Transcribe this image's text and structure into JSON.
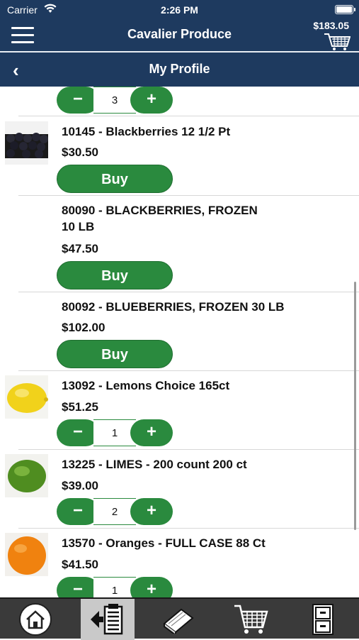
{
  "status_bar": {
    "carrier": "Carrier",
    "time": "2:26 PM"
  },
  "app_bar": {
    "title": "Cavalier Produce",
    "cart_total": "$183.05"
  },
  "sub_bar": {
    "title": "My Profile",
    "back_glyph": "‹"
  },
  "top_partial": {
    "qty": "3"
  },
  "products": [
    {
      "name": "10145 - Blackberries 12 1/2 Pt",
      "price": "$30.50",
      "action": "Buy",
      "image": "blackberries-photo"
    },
    {
      "name_line1": "80090 - BLACKBERRIES, FROZEN",
      "name_line2": "10 LB",
      "price": "$47.50",
      "action": "Buy"
    },
    {
      "name": "80092 - BLUEBERRIES, FROZEN 30 LB",
      "price": "$102.00",
      "action": "Buy"
    },
    {
      "name": "13092 - Lemons Choice 165ct",
      "price": "$51.25",
      "qty": "1",
      "image": "lemon-photo"
    },
    {
      "name": "13225 - LIMES - 200 count 200 ct",
      "price": "$39.00",
      "qty": "2",
      "image": "lime-photo"
    },
    {
      "name": "13570 - Oranges - FULL CASE 88 Ct",
      "price": "$41.50",
      "qty": "1",
      "image": "orange-photo"
    }
  ],
  "stepper": {
    "minus": "−",
    "plus": "+"
  },
  "tab_bar": {
    "tabs": [
      {
        "icon": "home-icon"
      },
      {
        "icon": "order-list-icon",
        "active": true
      },
      {
        "icon": "catalog-book-icon"
      },
      {
        "icon": "shopping-cart-icon"
      },
      {
        "icon": "file-cabinet-icon"
      }
    ]
  },
  "colors": {
    "header": "#1e3a5f",
    "button_green": "#2a8a3e",
    "tab_bar": "#3a3a3a"
  }
}
